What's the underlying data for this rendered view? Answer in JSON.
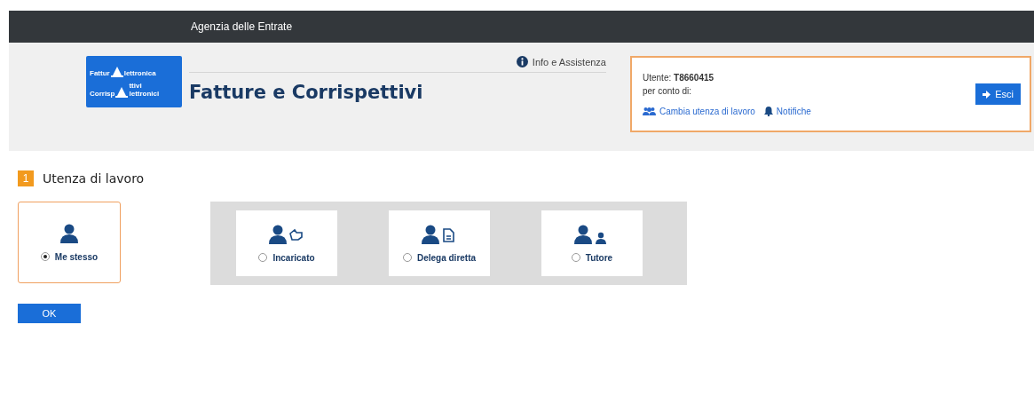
{
  "top_bar": {
    "title": "Agenzia delle Entrate"
  },
  "logo": {
    "lines": [
      {
        "parts": [
          "Fattur",
          "lettronica"
        ]
      },
      {
        "parts": [
          "Corrisp",
          "ttivi",
          "lettronici"
        ]
      }
    ]
  },
  "header": {
    "title": "Fatture e Corrispettivi",
    "info_link": "Info e Assistenza"
  },
  "user_box": {
    "user_label": "Utente:",
    "user_id": "T8660415",
    "on_behalf_label": "per conto di:",
    "change_link": "Cambia utenza di lavoro",
    "notifications_link": "Notifiche",
    "logout_button": "Esci"
  },
  "step": {
    "number": "1",
    "title": "Utenza di lavoro"
  },
  "options": [
    {
      "kind": "self",
      "label": "Me stesso",
      "selected": true
    },
    {
      "kind": "appointee",
      "label": "Incaricato",
      "selected": false
    },
    {
      "kind": "delegate",
      "label": "Delega diretta",
      "selected": false
    },
    {
      "kind": "tutor",
      "label": "Tutore",
      "selected": false
    }
  ],
  "ok_button": "OK"
}
